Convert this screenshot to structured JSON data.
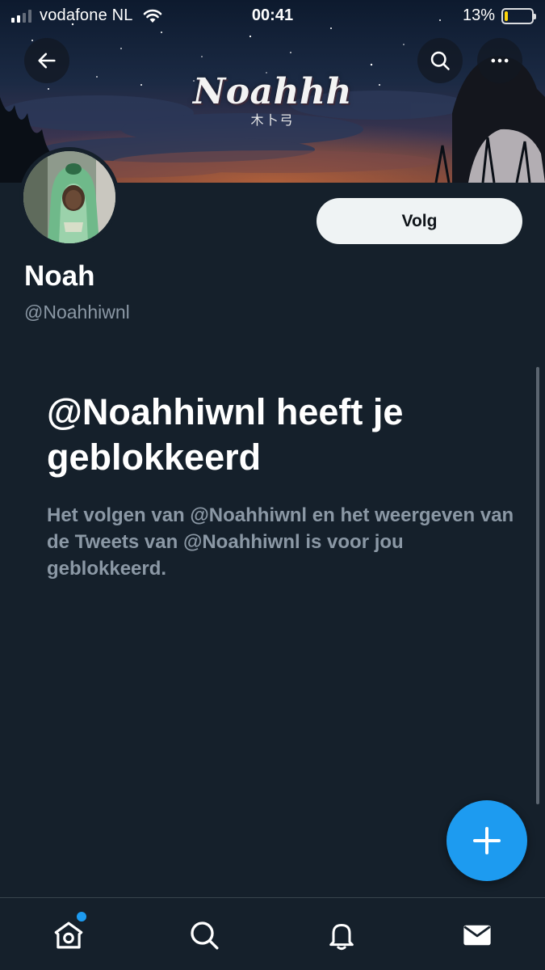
{
  "status_bar": {
    "carrier": "vodafone NL",
    "time": "00:41",
    "battery_percent": "13%",
    "battery_level": 0.13,
    "battery_color": "#ffd60a",
    "signal_bars": 2
  },
  "header": {
    "back_icon": "arrow-left-icon",
    "search_icon": "search-icon",
    "more_icon": "more-horizontal-icon"
  },
  "banner": {
    "logo_text": "Noahhh",
    "logo_subtext": "木卜弓"
  },
  "profile": {
    "name": "Noah",
    "handle": "@Noahhiwnl",
    "follow_label": "Volg"
  },
  "blocked": {
    "title": "@Noahhiwnl heeft je geblokkeerd",
    "body": "Het volgen van @Noahhiwnl en het weergeven van de Tweets van @Noahhiwnl is voor jou geblokkeerd."
  },
  "fab": {
    "icon": "plus-icon"
  },
  "tabbar": {
    "items": [
      {
        "name": "home",
        "icon": "home-icon",
        "has_badge": true
      },
      {
        "name": "search",
        "icon": "search-icon",
        "has_badge": false
      },
      {
        "name": "notifications",
        "icon": "bell-icon",
        "has_badge": false
      },
      {
        "name": "messages",
        "icon": "mail-icon",
        "has_badge": false
      }
    ]
  },
  "colors": {
    "background": "#15202b",
    "accent": "#1d9bf0",
    "secondary_text": "#8b98a5",
    "follow_button_bg": "#eff3f4"
  }
}
